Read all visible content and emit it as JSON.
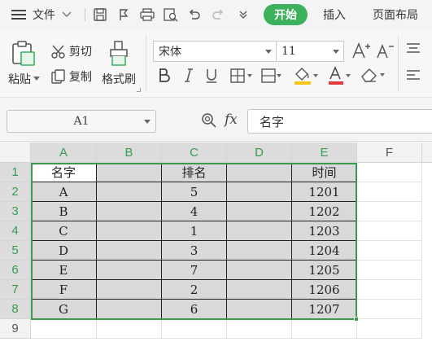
{
  "menubar": {
    "file_label": "文件",
    "tabs": [
      {
        "label": "开始",
        "active": true
      },
      {
        "label": "插入",
        "active": false
      },
      {
        "label": "页面布局",
        "active": false
      }
    ]
  },
  "ribbon": {
    "paste_label": "粘贴",
    "cut_label": "剪切",
    "copy_label": "复制",
    "format_painter_label": "格式刷",
    "font_name": "宋体",
    "font_size": "11"
  },
  "formula_bar": {
    "cell_ref": "A1",
    "fx_label": "fx",
    "content": "名字"
  },
  "sheet": {
    "columns": [
      "A",
      "B",
      "C",
      "D",
      "E",
      "F"
    ],
    "rows": [
      "1",
      "2",
      "3",
      "4",
      "5",
      "6",
      "7",
      "8",
      "9"
    ],
    "cells": [
      [
        "名字",
        "",
        "排名",
        "",
        "时间"
      ],
      [
        "A",
        "",
        "5",
        "",
        "1201"
      ],
      [
        "B",
        "",
        "4",
        "",
        "1202"
      ],
      [
        "C",
        "",
        "1",
        "",
        "1203"
      ],
      [
        "D",
        "",
        "3",
        "",
        "1204"
      ],
      [
        "E",
        "",
        "7",
        "",
        "1205"
      ],
      [
        "F",
        "",
        "2",
        "",
        "1206"
      ],
      [
        "G",
        "",
        "6",
        "",
        "1207"
      ]
    ]
  },
  "icons": [
    "menu-icon",
    "save-icon",
    "quick-format-icon",
    "print-icon",
    "print-preview-icon",
    "undo-icon",
    "redo-icon",
    "more-icon",
    "paste-icon",
    "scissors-icon",
    "copy-icon",
    "brush-icon",
    "font-grow-icon",
    "font-shrink-icon",
    "bold-icon",
    "italic-icon",
    "underline-icon",
    "border-icon",
    "fill-color-icon",
    "font-color-icon",
    "eraser-icon",
    "align-icon",
    "zoom-icon"
  ],
  "colors": {
    "accent": "#3cb05a",
    "selection": "#3a9b4f",
    "cell_fill": "#d9d9d9"
  }
}
